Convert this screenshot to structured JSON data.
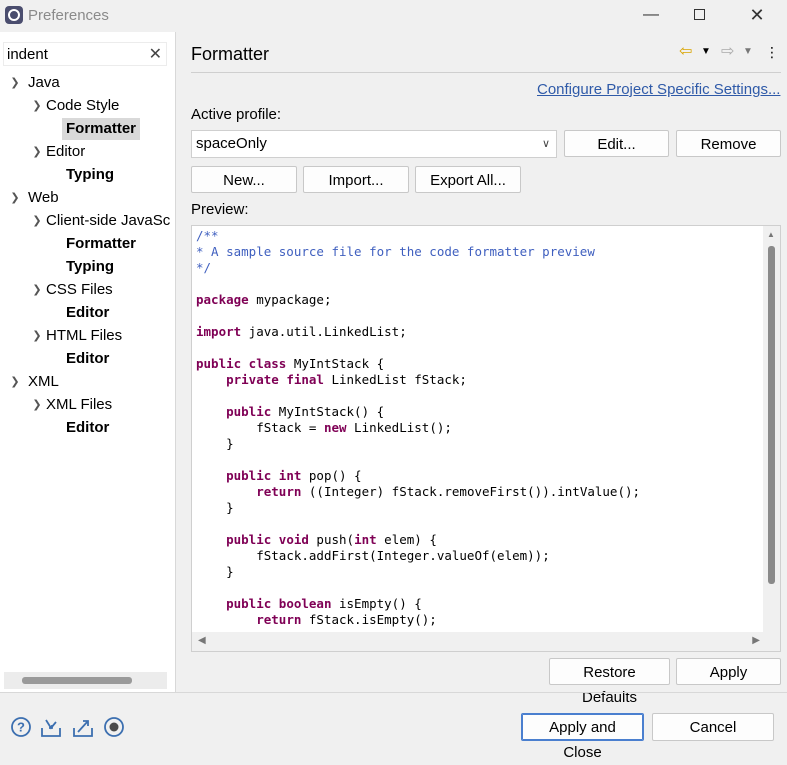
{
  "window": {
    "title": "Preferences",
    "minimize_glyph": "—",
    "close_glyph": "✕"
  },
  "filter": {
    "value": "indent",
    "clear_glyph": "✕"
  },
  "tree": {
    "java": "Java",
    "code_style": "Code Style",
    "formatter": "Formatter",
    "editor": "Editor",
    "typing": "Typing",
    "web": "Web",
    "client_side": "Client-side JavaSc",
    "client_formatter": "Formatter",
    "client_typing": "Typing",
    "css_files": "CSS Files",
    "css_editor": "Editor",
    "html_files": "HTML Files",
    "html_editor": "Editor",
    "xml": "XML",
    "xml_files": "XML Files",
    "xml_editor": "Editor"
  },
  "page": {
    "title": "Formatter",
    "configure_link": "Configure Project Specific Settings...",
    "active_profile_label": "Active profile:",
    "profile_value": "spaceOnly",
    "edit_button": "Edit...",
    "remove_button": "Remove",
    "new_button": "New...",
    "import_button": "Import...",
    "export_button": "Export All...",
    "preview_label": "Preview:",
    "restore_defaults_button": "Restore Defaults",
    "apply_button": "Apply"
  },
  "preview": {
    "c1": "/**",
    "c2": "* A sample source file for the code formatter preview",
    "c3": "*/",
    "package_kw": "package",
    "package_rest": " mypackage;",
    "import_kw": "import",
    "import_rest": " java.util.LinkedList;",
    "cls_kw": "public class",
    "cls_rest": " MyIntStack {",
    "field_kw": "private final",
    "field_rest": " LinkedList fStack;",
    "ctor_kw": "public",
    "ctor_rest": " MyIntStack() {",
    "ctor_body_a": "fStack = ",
    "ctor_body_kw": "new",
    "ctor_body_b": " LinkedList();",
    "close_brace": "}",
    "pop_kw": "public int",
    "pop_rest": " pop() {",
    "pop_ret_kw": "return",
    "pop_ret_rest": " ((Integer) fStack.removeFirst()).intValue();",
    "push_kw": "public void",
    "push_rest_a": " push(",
    "push_int_kw": "int",
    "push_rest_b": " elem) {",
    "push_body": "fStack.addFirst(Integer.valueOf(elem));",
    "empty_kw": "public boolean",
    "empty_rest": " isEmpty() {",
    "empty_ret_kw": "return",
    "empty_ret_rest": " fStack.isEmpty();"
  },
  "footer": {
    "apply_close_button": "Apply and Close",
    "cancel_button": "Cancel"
  }
}
